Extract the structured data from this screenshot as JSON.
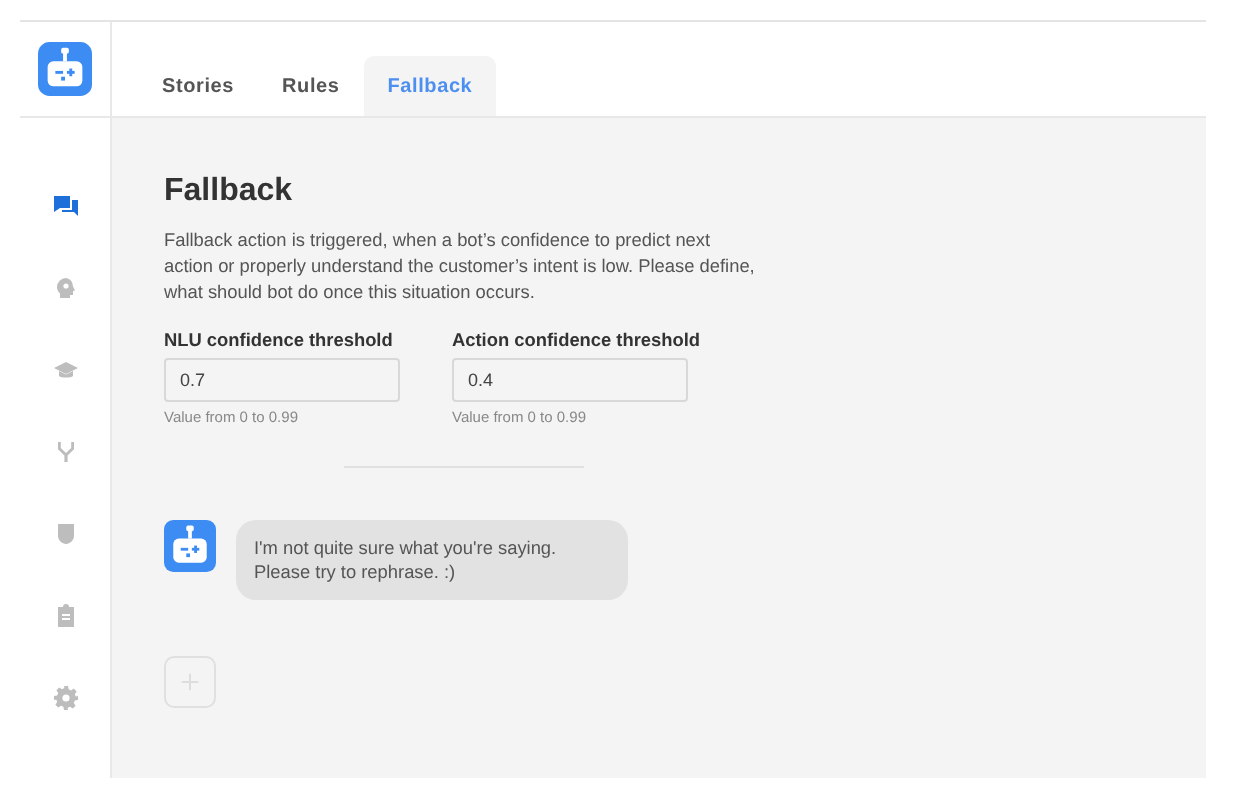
{
  "sidebar": {
    "items": [
      {
        "kind": "chat",
        "selected": true
      },
      {
        "kind": "head",
        "selected": false
      },
      {
        "kind": "cap",
        "selected": false
      },
      {
        "kind": "fork",
        "selected": false
      },
      {
        "kind": "shield",
        "selected": false
      },
      {
        "kind": "clipboard",
        "selected": false
      },
      {
        "kind": "gear",
        "selected": false
      }
    ]
  },
  "tabs": [
    {
      "label": "Stories",
      "selected": false
    },
    {
      "label": "Rules",
      "selected": false
    },
    {
      "label": "Fallback",
      "selected": true
    }
  ],
  "heading": "Fallback",
  "description": "Fallback action is triggered, when a bot’s confidence to predict next action or properly understand the customer’s intent is low. Please define, what should bot do once this situation occurs.",
  "fields": [
    {
      "label": "NLU confidence threshold",
      "value": "0.7",
      "hint": "Value from 0 to 0.99"
    },
    {
      "label": "Action confidence threshold",
      "value": "0.4",
      "hint": "Value from 0 to 0.99"
    }
  ],
  "message": "I'm not quite sure what you're saying.\nPlease try to rephrase. :)"
}
